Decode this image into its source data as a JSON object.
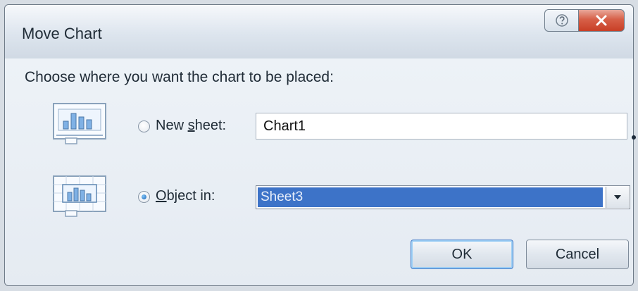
{
  "window": {
    "title": "Move Chart"
  },
  "dialog": {
    "prompt": "Choose where you want the chart to be placed:",
    "new_sheet": {
      "label_prefix": "New ",
      "label_mnemonic": "s",
      "label_suffix": "heet:",
      "value": "Chart1",
      "selected": false,
      "icon": "chart-sheet-icon"
    },
    "object_in": {
      "label_mnemonic": "O",
      "label_suffix": "bject in:",
      "value": "Sheet3",
      "selected": true,
      "icon": "embedded-chart-icon"
    },
    "buttons": {
      "ok": "OK",
      "cancel": "Cancel"
    }
  },
  "colors": {
    "selection": "#3d73c8",
    "close_button": "#c83f26",
    "default_button_focus": "#3f79c8"
  }
}
